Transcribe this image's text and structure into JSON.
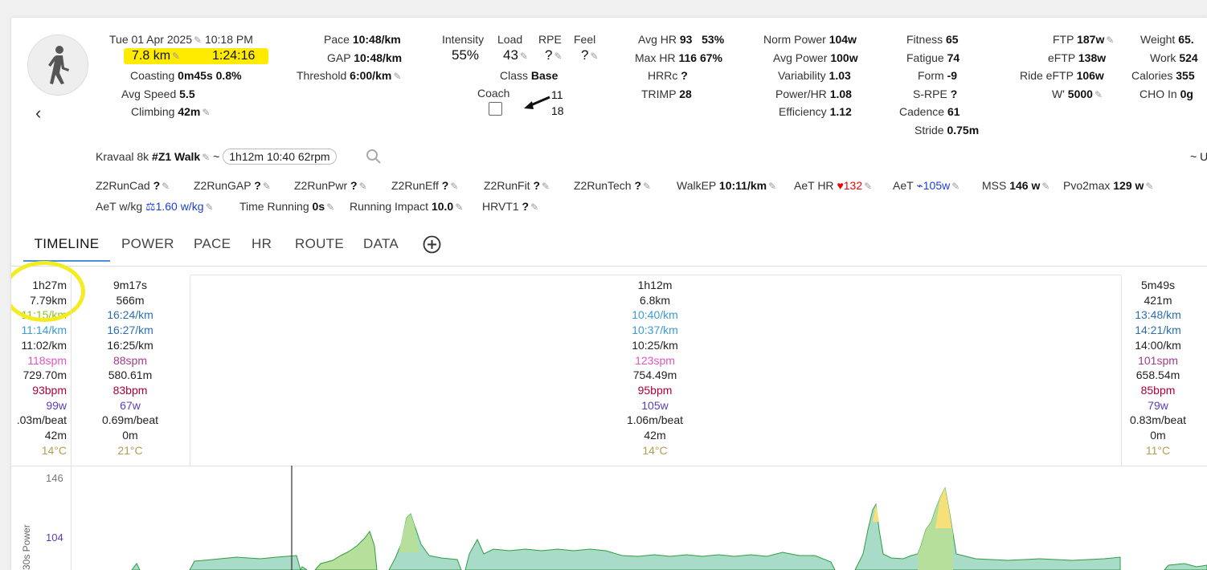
{
  "header": {
    "date": "Tue 01 Apr 2025",
    "time": "10:18 PM",
    "distance": "7.8 km",
    "duration": "1:24:16",
    "coasting_label": "Coasting",
    "coasting_value": "0m45s 0.8%",
    "avg_speed_label": "Avg Speed",
    "avg_speed_value": "5.5",
    "climbing_label": "Climbing",
    "climbing_value": "42m"
  },
  "pace": {
    "pace_label": "Pace",
    "pace_value": "10:48/km",
    "gap_label": "GAP",
    "gap_value": "10:48/km",
    "threshold_label": "Threshold",
    "threshold_value": "6:00/km"
  },
  "load": {
    "intensity_label": "Intensity",
    "intensity_value": "55%",
    "load_label": "Load",
    "load_value": "43",
    "rpe_label": "RPE",
    "rpe_value": "?",
    "feel_label": "Feel",
    "feel_value": "?",
    "class_label": "Class",
    "class_value": "Base",
    "coach_label": "Coach",
    "coach_num1": "11",
    "coach_num2": "18"
  },
  "hr": {
    "avg_hr_label": "Avg HR",
    "avg_hr_value": "93",
    "avg_hr_pct": "53%",
    "max_hr_label": "Max HR",
    "max_hr_value": "116",
    "max_hr_pct": "67%",
    "hrrc_label": "HRRc",
    "hrrc_value": "?",
    "trimp_label": "TRIMP",
    "trimp_value": "28"
  },
  "power": {
    "norm_label": "Norm Power",
    "norm_value": "104w",
    "avg_label": "Avg Power",
    "avg_value": "100w",
    "var_label": "Variability",
    "var_value": "1.03",
    "phr_label": "Power/HR",
    "phr_value": "1.08",
    "eff_label": "Efficiency",
    "eff_value": "1.12"
  },
  "fitness": {
    "fitness_label": "Fitness",
    "fitness_value": "65",
    "fatigue_label": "Fatigue",
    "fatigue_value": "74",
    "form_label": "Form",
    "form_value": "-9",
    "srpe_label": "S-RPE",
    "srpe_value": "?",
    "cadence_label": "Cadence",
    "cadence_value": "61",
    "stride_label": "Stride",
    "stride_value": "0.75m"
  },
  "ftp": {
    "ftp_label": "FTP",
    "ftp_value": "187w",
    "eftp_label": "eFTP",
    "eftp_value": "138w",
    "ride_label": "Ride eFTP",
    "ride_value": "106w",
    "wprime_label": "W'",
    "wprime_value": "5000"
  },
  "weight": {
    "weight_label": "Weight",
    "weight_value": "65.",
    "work_label": "Work",
    "work_value": "524",
    "cal_label": "Calories",
    "cal_value": "355",
    "cho_label": "CHO In",
    "cho_value": "0g"
  },
  "workout": {
    "name": "Kravaal 8k",
    "tag": "#Z1 Walk",
    "tilde": "~",
    "pill": "1h12m 10:40  62rpm",
    "right_tilde": "~ U"
  },
  "custom_fields": {
    "row1": [
      {
        "label": "Z2RunCad",
        "value": "?"
      },
      {
        "label": "Z2RunGAP",
        "value": "?"
      },
      {
        "label": "Z2RunPwr",
        "value": "?"
      },
      {
        "label": "Z2RunEff",
        "value": "?"
      },
      {
        "label": "Z2RunFit",
        "value": "?"
      },
      {
        "label": "Z2RunTech",
        "value": "?"
      },
      {
        "label": "WalkEP",
        "value": "10:11/km"
      },
      {
        "label": "AeT HR",
        "value": "132"
      },
      {
        "label": "AeT",
        "value": "105w"
      },
      {
        "label": "MSS",
        "value": "146 w"
      },
      {
        "label": "Pvo2max",
        "value": "129 w"
      }
    ],
    "row2": [
      {
        "label": "AeT w/kg",
        "value": "1.60 w/kg"
      },
      {
        "label": "Time Running",
        "value": "0s"
      },
      {
        "label": "Running Impact",
        "value": "10.0"
      },
      {
        "label": "HRVT1",
        "value": "?"
      }
    ]
  },
  "tabs": [
    "TIMELINE",
    "POWER",
    "PACE",
    "HR",
    "ROUTE",
    "DATA"
  ],
  "intervals": {
    "total": [
      "1h27m",
      "7.79km",
      "11:15/km",
      "11:14/km",
      "11:02/km",
      "118spm",
      "729.70m",
      "93bpm",
      "99w",
      ".03m/beat",
      "42m",
      "14°C"
    ],
    "seg1": [
      "9m17s",
      "566m",
      "16:24/km",
      "16:27/km",
      "16:25/km",
      "88spm",
      "580.61m",
      "83bpm",
      "67w",
      "0.69m/beat",
      "0m",
      "21°C"
    ],
    "seg2": [
      "1h12m",
      "6.8km",
      "10:40/km",
      "10:37/km",
      "10:25/km",
      "123spm",
      "754.49m",
      "95bpm",
      "105w",
      "1.06m/beat",
      "42m",
      "14°C"
    ],
    "seg3": [
      "5m49s",
      "421m",
      "13:48/km",
      "14:21/km",
      "14:00/km",
      "101spm",
      "658.54m",
      "85bpm",
      "79w",
      "0.83m/beat",
      "0m",
      "11°C"
    ]
  },
  "chart": {
    "y_label": "30s Power",
    "tick_146": "146",
    "tick_104": "104",
    "colors": {
      "fill": "#a8dcc8",
      "line": "#2e9e3e",
      "zone": "#b5df9a",
      "peak": "#f7e07a"
    }
  }
}
